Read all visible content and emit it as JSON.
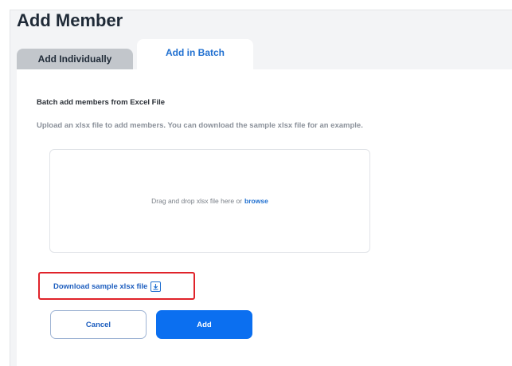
{
  "page": {
    "title": "Add Member"
  },
  "tabs": [
    {
      "label": "Add Individually",
      "active": false
    },
    {
      "label": "Add in Batch",
      "active": true
    }
  ],
  "batch": {
    "heading": "Batch add members from Excel File",
    "description": "Upload an xlsx file to add members. You can download the sample xlsx file for an example.",
    "dropzone_text": "Drag and drop xlsx file here or",
    "browse_label": "browse",
    "download_label": "Download sample xlsx file",
    "download_icon": "download-icon"
  },
  "actions": {
    "cancel_label": "Cancel",
    "add_label": "Add"
  },
  "colors": {
    "accent": "#0b6ff0",
    "link": "#1f6fd0",
    "highlight_border": "#e0232a",
    "inactive_tab": "#c2c6cb",
    "panel_bg": "#f3f4f6"
  }
}
